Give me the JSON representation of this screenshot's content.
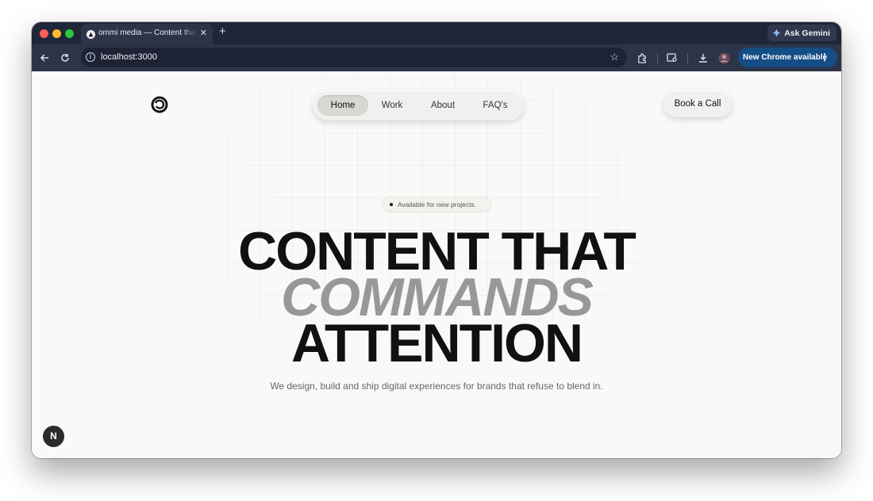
{
  "browser": {
    "tab_title": "ommi media — Content that c",
    "tab_close": "✕",
    "new_tab": "+",
    "ask_gemini": "Ask Gemini",
    "url": "localhost:3000",
    "update_label": "New Chrome available",
    "traffic_light_colors": [
      "#ff5f57",
      "#febc2e",
      "#28c840"
    ]
  },
  "nav": {
    "items": [
      {
        "label": "Home",
        "active": true
      },
      {
        "label": "Work",
        "active": false
      },
      {
        "label": "About",
        "active": false
      },
      {
        "label": "FAQ's",
        "active": false
      }
    ],
    "cta_label": "Book a Call"
  },
  "hero": {
    "badge": "Available for new projects.",
    "headline_line1": "CONTENT THAT",
    "headline_line2": "COMMANDS",
    "headline_line3": "ATTENTION",
    "subtitle": "We design, build and ship digital experiences for brands that refuse to blend in."
  },
  "devtools": {
    "next_badge": "N"
  },
  "colors": {
    "tabstrip": "#1f2638",
    "toolbar": "#2c3548",
    "update_button": "#154d86",
    "page_background": "#faf9f7",
    "headline": "#111111",
    "headline_accent": "#98989b"
  }
}
